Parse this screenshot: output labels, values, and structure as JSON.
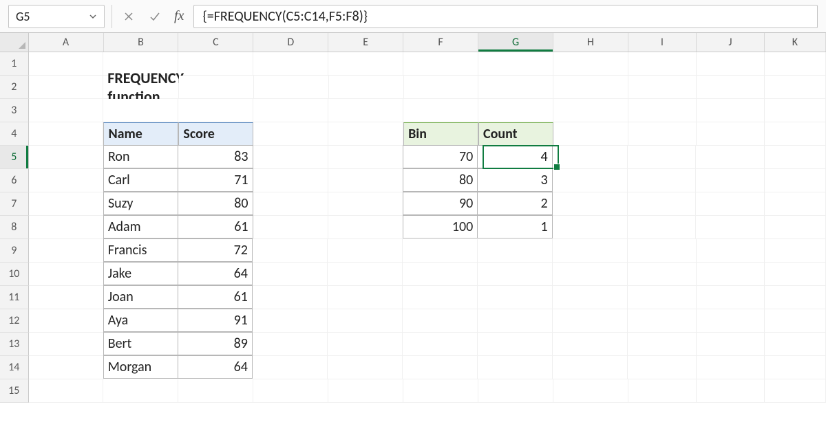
{
  "nameBox": "G5",
  "formula": "{=FREQUENCY(C5:C14,F5:F8)}",
  "title": "FREQUENCY function",
  "columnLetters": [
    "A",
    "B",
    "C",
    "D",
    "E",
    "F",
    "G",
    "H",
    "I",
    "J",
    "K"
  ],
  "rowNumbers": [
    "1",
    "2",
    "3",
    "4",
    "5",
    "6",
    "7",
    "8",
    "9",
    "10",
    "11",
    "12",
    "13",
    "14",
    "15"
  ],
  "activeCol": "G",
  "activeRow": "5",
  "colWidths": {
    "A": 110,
    "B": 110,
    "C": 110,
    "D": 110,
    "E": 110,
    "F": 110,
    "G": 110,
    "H": 110,
    "I": 100,
    "J": 100,
    "K": 90
  },
  "table1": {
    "headers": {
      "name": "Name",
      "score": "Score"
    },
    "rows": [
      {
        "name": "Ron",
        "score": "83"
      },
      {
        "name": "Carl",
        "score": "71"
      },
      {
        "name": "Suzy",
        "score": "80"
      },
      {
        "name": "Adam",
        "score": "61"
      },
      {
        "name": "Francis",
        "score": "72"
      },
      {
        "name": "Jake",
        "score": "64"
      },
      {
        "name": "Joan",
        "score": "61"
      },
      {
        "name": "Aya",
        "score": "91"
      },
      {
        "name": "Bert",
        "score": "89"
      },
      {
        "name": "Morgan",
        "score": "64"
      }
    ]
  },
  "table2": {
    "headers": {
      "bin": "Bin",
      "count": "Count"
    },
    "rows": [
      {
        "bin": "70",
        "count": "4"
      },
      {
        "bin": "80",
        "count": "3"
      },
      {
        "bin": "90",
        "count": "2"
      },
      {
        "bin": "100",
        "count": "1"
      }
    ]
  }
}
